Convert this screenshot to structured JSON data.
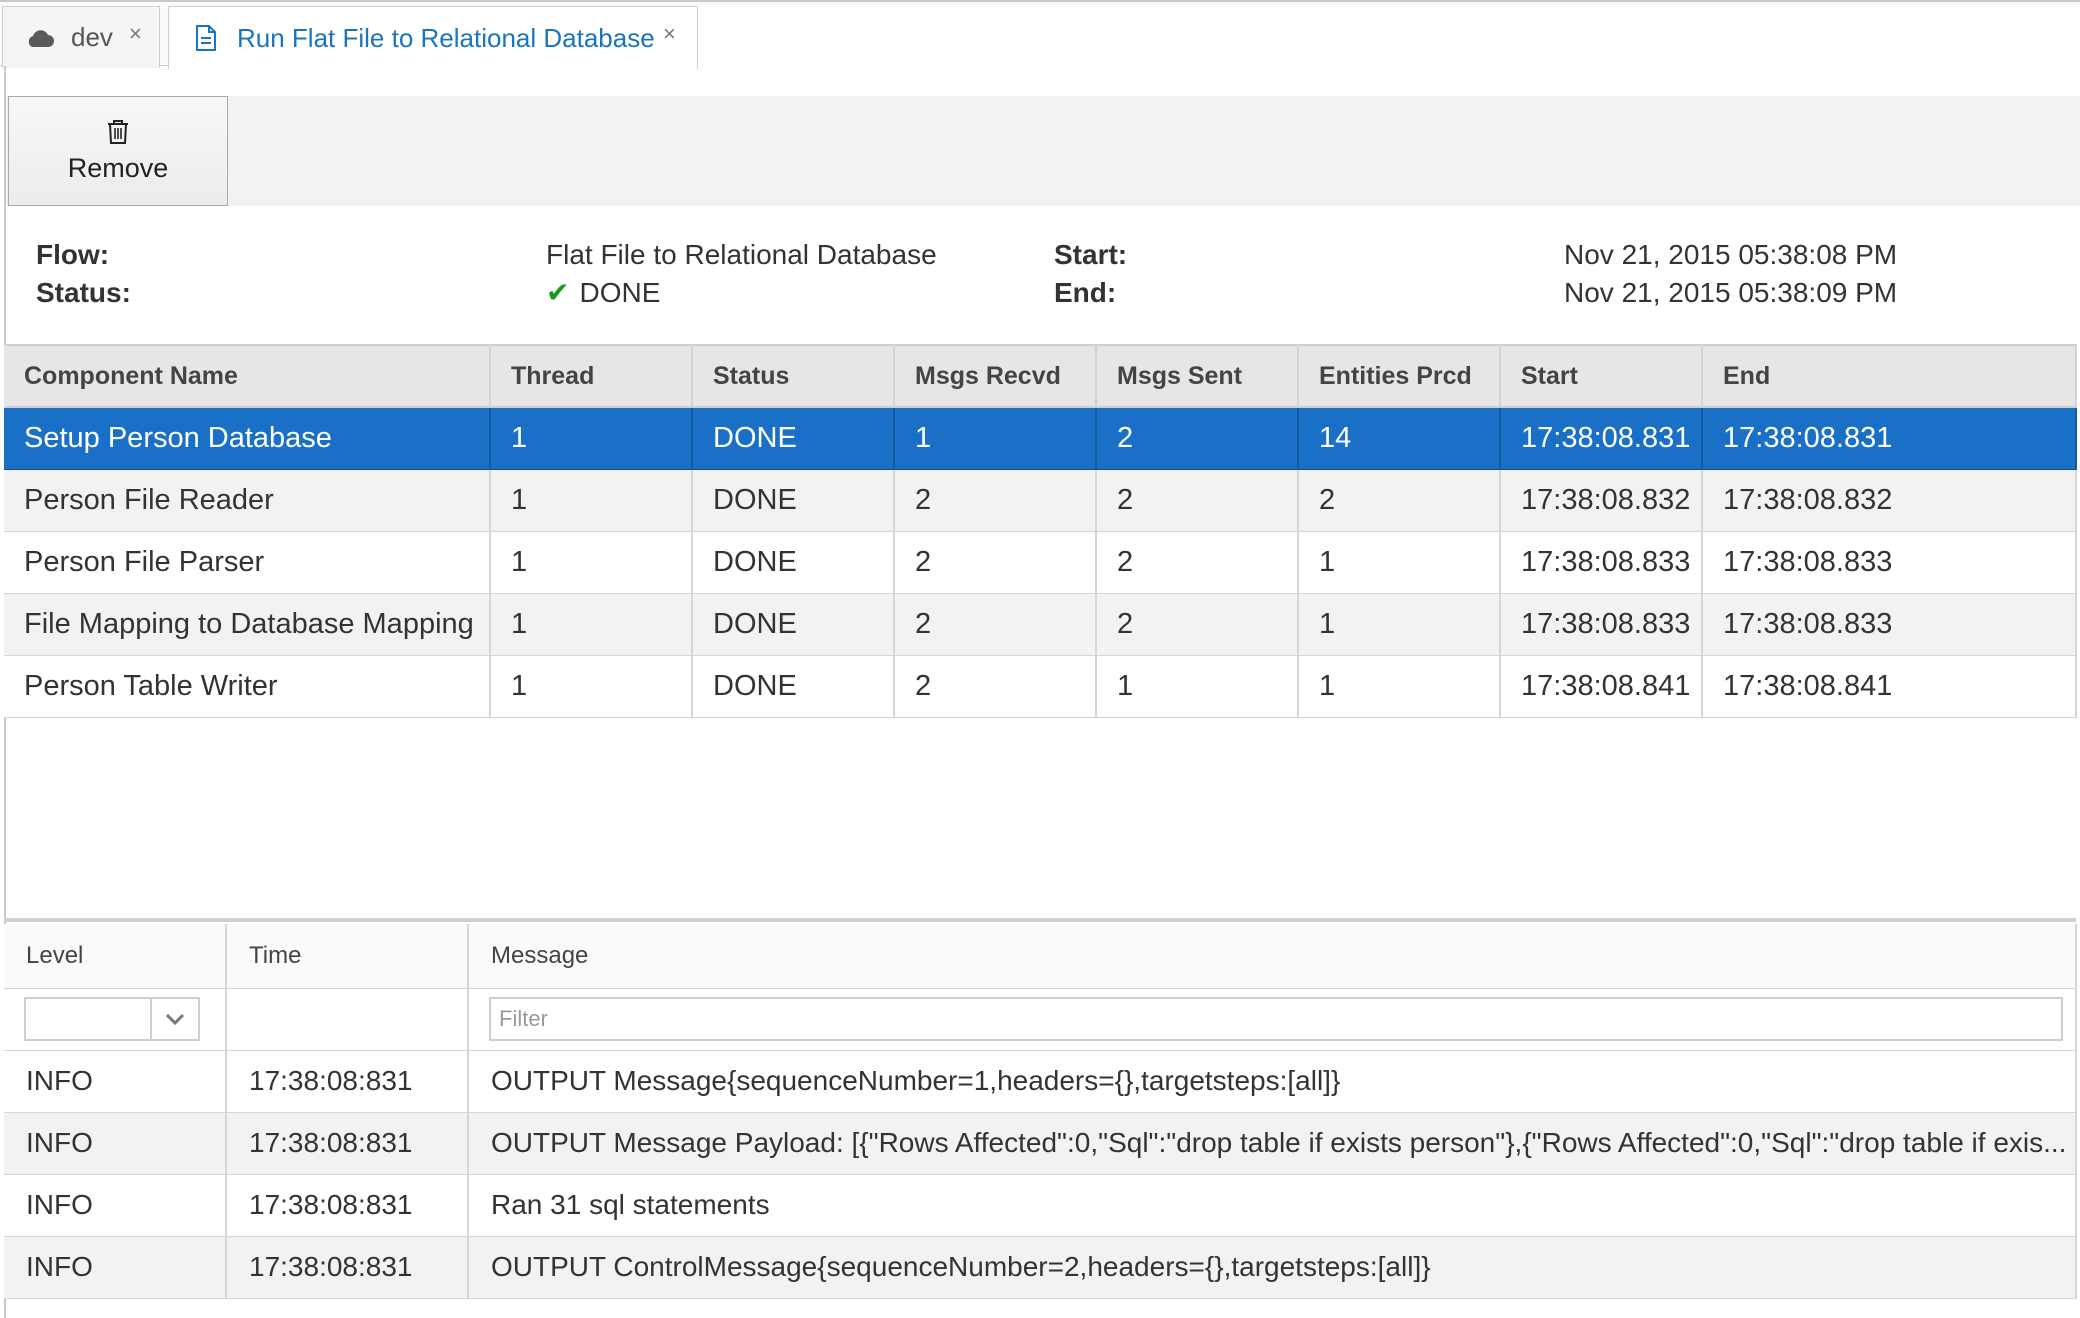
{
  "tabs": [
    {
      "label": "dev",
      "icon": "cloud-icon",
      "close": "×"
    },
    {
      "label": "Run Flat File to Relational Database",
      "icon": "document-icon",
      "close": "×"
    }
  ],
  "toolbar": {
    "remove_label": "Remove",
    "remove_icon": "trash-icon"
  },
  "summary": {
    "flow_label": "Flow:",
    "flow_value": "Flat File to Relational Database",
    "status_label": "Status:",
    "status_value": "DONE",
    "status_icon": "check-icon",
    "start_label": "Start:",
    "start_value": "Nov 21, 2015 05:38:08 PM",
    "end_label": "End:",
    "end_value": "Nov 21, 2015 05:38:09 PM"
  },
  "components": {
    "columns": [
      "Component Name",
      "Thread",
      "Status",
      "Msgs Recvd",
      "Msgs Sent",
      "Entities Prcd",
      "Start",
      "End"
    ],
    "rows": [
      [
        "Setup Person Database",
        "1",
        "DONE",
        "1",
        "2",
        "14",
        "17:38:08.831",
        "17:38:08.831"
      ],
      [
        "Person File Reader",
        "1",
        "DONE",
        "2",
        "2",
        "2",
        "17:38:08.832",
        "17:38:08.832"
      ],
      [
        "Person File Parser",
        "1",
        "DONE",
        "2",
        "2",
        "1",
        "17:38:08.833",
        "17:38:08.833"
      ],
      [
        "File Mapping to Database Mapping",
        "1",
        "DONE",
        "2",
        "2",
        "1",
        "17:38:08.833",
        "17:38:08.833"
      ],
      [
        "Person Table Writer",
        "1",
        "DONE",
        "2",
        "1",
        "1",
        "17:38:08.841",
        "17:38:08.841"
      ]
    ],
    "selected_row": 0
  },
  "log": {
    "columns": [
      "Level",
      "Time",
      "Message"
    ],
    "filter_placeholder": "Filter",
    "level_selected": "",
    "rows": [
      [
        "INFO",
        "17:38:08:831",
        "OUTPUT Message{sequenceNumber=1,headers={},targetsteps:[all]}"
      ],
      [
        "INFO",
        "17:38:08:831",
        "OUTPUT Message Payload: [{\"Rows Affected\":0,\"Sql\":\"drop table if exists person\"},{\"Rows Affected\":0,\"Sql\":\"drop table if exis..."
      ],
      [
        "INFO",
        "17:38:08:831",
        "Ran 31 sql statements"
      ],
      [
        "INFO",
        "17:38:08:831",
        "OUTPUT ControlMessage{sequenceNumber=2,headers={},targetsteps:[all]}"
      ]
    ]
  },
  "colors": {
    "accent": "#1b75bb",
    "selection": "#1a70c6",
    "success": "#1a9b1a"
  }
}
